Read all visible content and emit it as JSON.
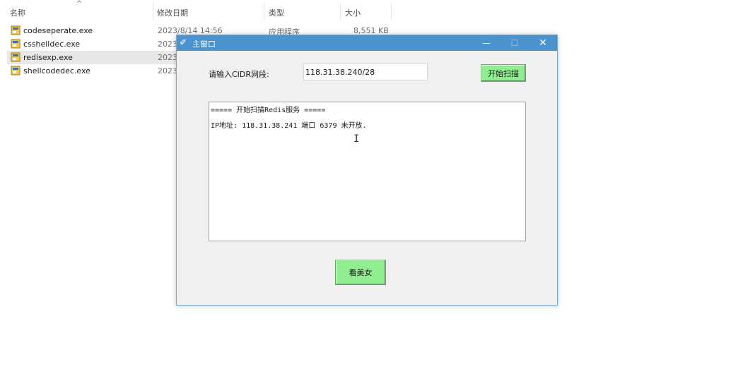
{
  "explorer": {
    "columns": [
      "名称",
      "修改日期",
      "类型",
      "大小"
    ],
    "files": [
      {
        "name": "codeseperate.exe",
        "date": "2023/8/14 14:56",
        "type": "应用程序",
        "size": "8,551 KB",
        "selected": false
      },
      {
        "name": "csshelldec.exe",
        "date": "2023",
        "type": "",
        "size": "",
        "selected": false
      },
      {
        "name": "redisexp.exe",
        "date": "2023",
        "type": "",
        "size": "",
        "selected": true
      },
      {
        "name": "shellcodedec.exe",
        "date": "2023",
        "type": "",
        "size": "",
        "selected": false
      }
    ]
  },
  "window": {
    "title": "主窗口",
    "min_glyph": "—",
    "max_glyph": "☐",
    "close_glyph": "✕",
    "cidr_label": "请输入CIDR网段:",
    "cidr_value": "118.31.38.240/28",
    "scan_button": "开始扫描",
    "output_lines": [
      "===== 开始扫描Redis服务 =====",
      "IP地址: 118.31.38.241 端口 6379 未开放."
    ],
    "girl_button": "看美女"
  },
  "colors": {
    "titlebar": "#4a93cf",
    "button_green": "#90ee90",
    "window_bg": "#f0f0f0"
  }
}
